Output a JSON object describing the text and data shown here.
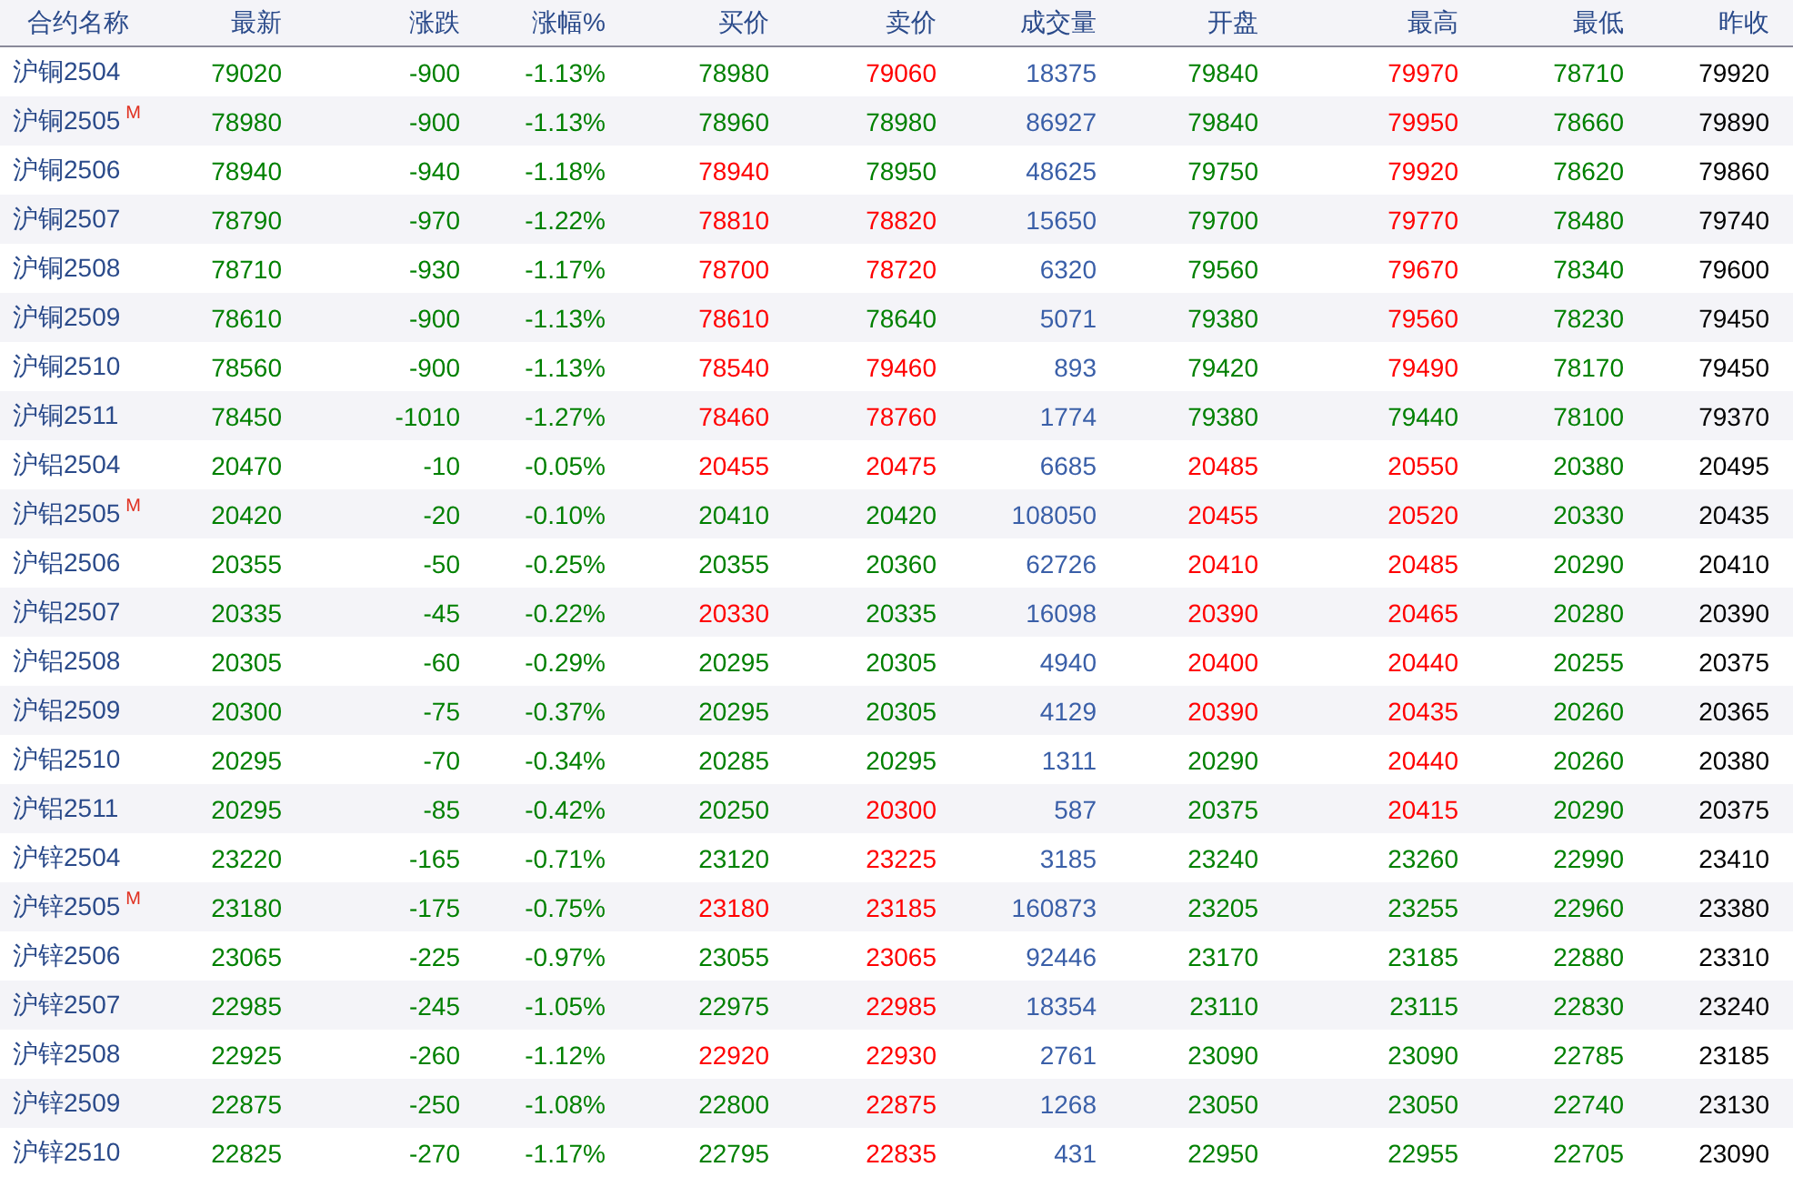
{
  "columns": [
    "合约名称",
    "最新",
    "涨跌",
    "涨幅%",
    "买价",
    "卖价",
    "成交量",
    "开盘",
    "最高",
    "最低",
    "昨收"
  ],
  "rows": [
    {
      "name": "沪铜2504",
      "cells": [
        {
          "text": "79020",
          "kind": "down"
        },
        {
          "text": "-900",
          "kind": "down"
        },
        {
          "text": "-1.13%",
          "kind": "down"
        },
        {
          "text": "78980",
          "kind": "down"
        },
        {
          "text": "79060",
          "kind": "up"
        },
        {
          "text": "18375",
          "kind": "volume"
        },
        {
          "text": "79840",
          "kind": "down"
        },
        {
          "text": "79970",
          "kind": "up"
        },
        {
          "text": "78710",
          "kind": "down"
        },
        {
          "text": "79920",
          "kind": "close"
        }
      ]
    },
    {
      "name": "沪铜2505",
      "badge": "M",
      "cells": [
        {
          "text": "78980",
          "kind": "down"
        },
        {
          "text": "-900",
          "kind": "down"
        },
        {
          "text": "-1.13%",
          "kind": "down"
        },
        {
          "text": "78960",
          "kind": "down"
        },
        {
          "text": "78980",
          "kind": "down"
        },
        {
          "text": "86927",
          "kind": "volume"
        },
        {
          "text": "79840",
          "kind": "down"
        },
        {
          "text": "79950",
          "kind": "up"
        },
        {
          "text": "78660",
          "kind": "down"
        },
        {
          "text": "79890",
          "kind": "close"
        }
      ]
    },
    {
      "name": "沪铜2506",
      "cells": [
        {
          "text": "78940",
          "kind": "down"
        },
        {
          "text": "-940",
          "kind": "down"
        },
        {
          "text": "-1.18%",
          "kind": "down"
        },
        {
          "text": "78940",
          "kind": "up"
        },
        {
          "text": "78950",
          "kind": "down"
        },
        {
          "text": "48625",
          "kind": "volume"
        },
        {
          "text": "79750",
          "kind": "down"
        },
        {
          "text": "79920",
          "kind": "up"
        },
        {
          "text": "78620",
          "kind": "down"
        },
        {
          "text": "79860",
          "kind": "close"
        }
      ]
    },
    {
      "name": "沪铜2507",
      "cells": [
        {
          "text": "78790",
          "kind": "down"
        },
        {
          "text": "-970",
          "kind": "down"
        },
        {
          "text": "-1.22%",
          "kind": "down"
        },
        {
          "text": "78810",
          "kind": "up"
        },
        {
          "text": "78820",
          "kind": "up"
        },
        {
          "text": "15650",
          "kind": "volume"
        },
        {
          "text": "79700",
          "kind": "down"
        },
        {
          "text": "79770",
          "kind": "up"
        },
        {
          "text": "78480",
          "kind": "down"
        },
        {
          "text": "79740",
          "kind": "close"
        }
      ]
    },
    {
      "name": "沪铜2508",
      "cells": [
        {
          "text": "78710",
          "kind": "down"
        },
        {
          "text": "-930",
          "kind": "down"
        },
        {
          "text": "-1.17%",
          "kind": "down"
        },
        {
          "text": "78700",
          "kind": "up"
        },
        {
          "text": "78720",
          "kind": "up"
        },
        {
          "text": "6320",
          "kind": "volume"
        },
        {
          "text": "79560",
          "kind": "down"
        },
        {
          "text": "79670",
          "kind": "up"
        },
        {
          "text": "78340",
          "kind": "down"
        },
        {
          "text": "79600",
          "kind": "close"
        }
      ]
    },
    {
      "name": "沪铜2509",
      "cells": [
        {
          "text": "78610",
          "kind": "down"
        },
        {
          "text": "-900",
          "kind": "down"
        },
        {
          "text": "-1.13%",
          "kind": "down"
        },
        {
          "text": "78610",
          "kind": "up"
        },
        {
          "text": "78640",
          "kind": "down"
        },
        {
          "text": "5071",
          "kind": "volume"
        },
        {
          "text": "79380",
          "kind": "down"
        },
        {
          "text": "79560",
          "kind": "up"
        },
        {
          "text": "78230",
          "kind": "down"
        },
        {
          "text": "79450",
          "kind": "close"
        }
      ]
    },
    {
      "name": "沪铜2510",
      "cells": [
        {
          "text": "78560",
          "kind": "down"
        },
        {
          "text": "-900",
          "kind": "down"
        },
        {
          "text": "-1.13%",
          "kind": "down"
        },
        {
          "text": "78540",
          "kind": "up"
        },
        {
          "text": "79460",
          "kind": "up"
        },
        {
          "text": "893",
          "kind": "volume"
        },
        {
          "text": "79420",
          "kind": "down"
        },
        {
          "text": "79490",
          "kind": "up"
        },
        {
          "text": "78170",
          "kind": "down"
        },
        {
          "text": "79450",
          "kind": "close"
        }
      ]
    },
    {
      "name": "沪铜2511",
      "cells": [
        {
          "text": "78450",
          "kind": "down"
        },
        {
          "text": "-1010",
          "kind": "down"
        },
        {
          "text": "-1.27%",
          "kind": "down"
        },
        {
          "text": "78460",
          "kind": "up"
        },
        {
          "text": "78760",
          "kind": "up"
        },
        {
          "text": "1774",
          "kind": "volume"
        },
        {
          "text": "79380",
          "kind": "down"
        },
        {
          "text": "79440",
          "kind": "down"
        },
        {
          "text": "78100",
          "kind": "down"
        },
        {
          "text": "79370",
          "kind": "close"
        }
      ]
    },
    {
      "name": "沪铝2504",
      "cells": [
        {
          "text": "20470",
          "kind": "down"
        },
        {
          "text": "-10",
          "kind": "down"
        },
        {
          "text": "-0.05%",
          "kind": "down"
        },
        {
          "text": "20455",
          "kind": "up"
        },
        {
          "text": "20475",
          "kind": "up"
        },
        {
          "text": "6685",
          "kind": "volume"
        },
        {
          "text": "20485",
          "kind": "up"
        },
        {
          "text": "20550",
          "kind": "up"
        },
        {
          "text": "20380",
          "kind": "down"
        },
        {
          "text": "20495",
          "kind": "close"
        }
      ]
    },
    {
      "name": "沪铝2505",
      "badge": "M",
      "cells": [
        {
          "text": "20420",
          "kind": "down"
        },
        {
          "text": "-20",
          "kind": "down"
        },
        {
          "text": "-0.10%",
          "kind": "down"
        },
        {
          "text": "20410",
          "kind": "down"
        },
        {
          "text": "20420",
          "kind": "down"
        },
        {
          "text": "108050",
          "kind": "volume"
        },
        {
          "text": "20455",
          "kind": "up"
        },
        {
          "text": "20520",
          "kind": "up"
        },
        {
          "text": "20330",
          "kind": "down"
        },
        {
          "text": "20435",
          "kind": "close"
        }
      ]
    },
    {
      "name": "沪铝2506",
      "cells": [
        {
          "text": "20355",
          "kind": "down"
        },
        {
          "text": "-50",
          "kind": "down"
        },
        {
          "text": "-0.25%",
          "kind": "down"
        },
        {
          "text": "20355",
          "kind": "down"
        },
        {
          "text": "20360",
          "kind": "down"
        },
        {
          "text": "62726",
          "kind": "volume"
        },
        {
          "text": "20410",
          "kind": "up"
        },
        {
          "text": "20485",
          "kind": "up"
        },
        {
          "text": "20290",
          "kind": "down"
        },
        {
          "text": "20410",
          "kind": "close"
        }
      ]
    },
    {
      "name": "沪铝2507",
      "cells": [
        {
          "text": "20335",
          "kind": "down"
        },
        {
          "text": "-45",
          "kind": "down"
        },
        {
          "text": "-0.22%",
          "kind": "down"
        },
        {
          "text": "20330",
          "kind": "up"
        },
        {
          "text": "20335",
          "kind": "down"
        },
        {
          "text": "16098",
          "kind": "volume"
        },
        {
          "text": "20390",
          "kind": "up"
        },
        {
          "text": "20465",
          "kind": "up"
        },
        {
          "text": "20280",
          "kind": "down"
        },
        {
          "text": "20390",
          "kind": "close"
        }
      ]
    },
    {
      "name": "沪铝2508",
      "cells": [
        {
          "text": "20305",
          "kind": "down"
        },
        {
          "text": "-60",
          "kind": "down"
        },
        {
          "text": "-0.29%",
          "kind": "down"
        },
        {
          "text": "20295",
          "kind": "down"
        },
        {
          "text": "20305",
          "kind": "down"
        },
        {
          "text": "4940",
          "kind": "volume"
        },
        {
          "text": "20400",
          "kind": "up"
        },
        {
          "text": "20440",
          "kind": "up"
        },
        {
          "text": "20255",
          "kind": "down"
        },
        {
          "text": "20375",
          "kind": "close"
        }
      ]
    },
    {
      "name": "沪铝2509",
      "cells": [
        {
          "text": "20300",
          "kind": "down"
        },
        {
          "text": "-75",
          "kind": "down"
        },
        {
          "text": "-0.37%",
          "kind": "down"
        },
        {
          "text": "20295",
          "kind": "down"
        },
        {
          "text": "20305",
          "kind": "down"
        },
        {
          "text": "4129",
          "kind": "volume"
        },
        {
          "text": "20390",
          "kind": "up"
        },
        {
          "text": "20435",
          "kind": "up"
        },
        {
          "text": "20260",
          "kind": "down"
        },
        {
          "text": "20365",
          "kind": "close"
        }
      ]
    },
    {
      "name": "沪铝2510",
      "cells": [
        {
          "text": "20295",
          "kind": "down"
        },
        {
          "text": "-70",
          "kind": "down"
        },
        {
          "text": "-0.34%",
          "kind": "down"
        },
        {
          "text": "20285",
          "kind": "down"
        },
        {
          "text": "20295",
          "kind": "down"
        },
        {
          "text": "1311",
          "kind": "volume"
        },
        {
          "text": "20290",
          "kind": "down"
        },
        {
          "text": "20440",
          "kind": "up"
        },
        {
          "text": "20260",
          "kind": "down"
        },
        {
          "text": "20380",
          "kind": "close"
        }
      ]
    },
    {
      "name": "沪铝2511",
      "cells": [
        {
          "text": "20295",
          "kind": "down"
        },
        {
          "text": "-85",
          "kind": "down"
        },
        {
          "text": "-0.42%",
          "kind": "down"
        },
        {
          "text": "20250",
          "kind": "down"
        },
        {
          "text": "20300",
          "kind": "up"
        },
        {
          "text": "587",
          "kind": "volume"
        },
        {
          "text": "20375",
          "kind": "down"
        },
        {
          "text": "20415",
          "kind": "up"
        },
        {
          "text": "20290",
          "kind": "down"
        },
        {
          "text": "20375",
          "kind": "close"
        }
      ]
    },
    {
      "name": "沪锌2504",
      "cells": [
        {
          "text": "23220",
          "kind": "down"
        },
        {
          "text": "-165",
          "kind": "down"
        },
        {
          "text": "-0.71%",
          "kind": "down"
        },
        {
          "text": "23120",
          "kind": "down"
        },
        {
          "text": "23225",
          "kind": "up"
        },
        {
          "text": "3185",
          "kind": "volume"
        },
        {
          "text": "23240",
          "kind": "down"
        },
        {
          "text": "23260",
          "kind": "down"
        },
        {
          "text": "22990",
          "kind": "down"
        },
        {
          "text": "23410",
          "kind": "close"
        }
      ]
    },
    {
      "name": "沪锌2505",
      "badge": "M",
      "cells": [
        {
          "text": "23180",
          "kind": "down"
        },
        {
          "text": "-175",
          "kind": "down"
        },
        {
          "text": "-0.75%",
          "kind": "down"
        },
        {
          "text": "23180",
          "kind": "up"
        },
        {
          "text": "23185",
          "kind": "up"
        },
        {
          "text": "160873",
          "kind": "volume"
        },
        {
          "text": "23205",
          "kind": "down"
        },
        {
          "text": "23255",
          "kind": "down"
        },
        {
          "text": "22960",
          "kind": "down"
        },
        {
          "text": "23380",
          "kind": "close"
        }
      ]
    },
    {
      "name": "沪锌2506",
      "cells": [
        {
          "text": "23065",
          "kind": "down"
        },
        {
          "text": "-225",
          "kind": "down"
        },
        {
          "text": "-0.97%",
          "kind": "down"
        },
        {
          "text": "23055",
          "kind": "down"
        },
        {
          "text": "23065",
          "kind": "up"
        },
        {
          "text": "92446",
          "kind": "volume"
        },
        {
          "text": "23170",
          "kind": "down"
        },
        {
          "text": "23185",
          "kind": "down"
        },
        {
          "text": "22880",
          "kind": "down"
        },
        {
          "text": "23310",
          "kind": "close"
        }
      ]
    },
    {
      "name": "沪锌2507",
      "cells": [
        {
          "text": "22985",
          "kind": "down"
        },
        {
          "text": "-245",
          "kind": "down"
        },
        {
          "text": "-1.05%",
          "kind": "down"
        },
        {
          "text": "22975",
          "kind": "down"
        },
        {
          "text": "22985",
          "kind": "up"
        },
        {
          "text": "18354",
          "kind": "volume"
        },
        {
          "text": "23110",
          "kind": "down"
        },
        {
          "text": "23115",
          "kind": "down"
        },
        {
          "text": "22830",
          "kind": "down"
        },
        {
          "text": "23240",
          "kind": "close"
        }
      ]
    },
    {
      "name": "沪锌2508",
      "cells": [
        {
          "text": "22925",
          "kind": "down"
        },
        {
          "text": "-260",
          "kind": "down"
        },
        {
          "text": "-1.12%",
          "kind": "down"
        },
        {
          "text": "22920",
          "kind": "up"
        },
        {
          "text": "22930",
          "kind": "up"
        },
        {
          "text": "2761",
          "kind": "volume"
        },
        {
          "text": "23090",
          "kind": "down"
        },
        {
          "text": "23090",
          "kind": "down"
        },
        {
          "text": "22785",
          "kind": "down"
        },
        {
          "text": "23185",
          "kind": "close"
        }
      ]
    },
    {
      "name": "沪锌2509",
      "cells": [
        {
          "text": "22875",
          "kind": "down"
        },
        {
          "text": "-250",
          "kind": "down"
        },
        {
          "text": "-1.08%",
          "kind": "down"
        },
        {
          "text": "22800",
          "kind": "down"
        },
        {
          "text": "22875",
          "kind": "up"
        },
        {
          "text": "1268",
          "kind": "volume"
        },
        {
          "text": "23050",
          "kind": "down"
        },
        {
          "text": "23050",
          "kind": "down"
        },
        {
          "text": "22740",
          "kind": "down"
        },
        {
          "text": "23130",
          "kind": "close"
        }
      ]
    },
    {
      "name": "沪锌2510",
      "cells": [
        {
          "text": "22825",
          "kind": "down"
        },
        {
          "text": "-270",
          "kind": "down"
        },
        {
          "text": "-1.17%",
          "kind": "down"
        },
        {
          "text": "22795",
          "kind": "down"
        },
        {
          "text": "22835",
          "kind": "up"
        },
        {
          "text": "431",
          "kind": "volume"
        },
        {
          "text": "22950",
          "kind": "down"
        },
        {
          "text": "22955",
          "kind": "down"
        },
        {
          "text": "22705",
          "kind": "down"
        },
        {
          "text": "23090",
          "kind": "close"
        }
      ]
    }
  ]
}
